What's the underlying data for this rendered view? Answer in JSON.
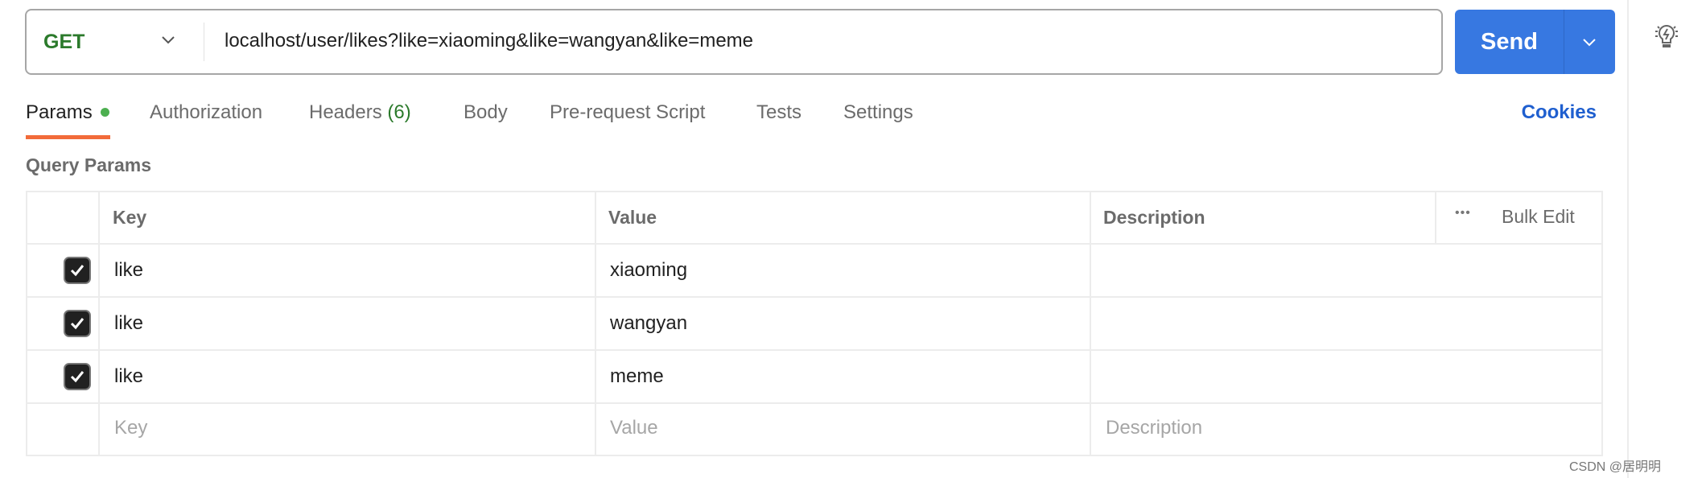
{
  "request": {
    "method": "GET",
    "url": "localhost/user/likes?like=xiaoming&like=wangyan&like=meme",
    "send_label": "Send"
  },
  "tabs": [
    {
      "label": "Params",
      "active": true,
      "has_dot": true
    },
    {
      "label": "Authorization"
    },
    {
      "label": "Headers",
      "count": "(6)"
    },
    {
      "label": "Body"
    },
    {
      "label": "Pre-request Script"
    },
    {
      "label": "Tests"
    },
    {
      "label": "Settings"
    }
  ],
  "cookies_label": "Cookies",
  "section_title": "Query Params",
  "table": {
    "headers": {
      "key": "Key",
      "value": "Value",
      "description": "Description",
      "bulk_edit": "Bulk Edit",
      "more": "•••"
    },
    "rows": [
      {
        "checked": true,
        "key": "like",
        "value": "xiaoming",
        "description": ""
      },
      {
        "checked": true,
        "key": "like",
        "value": "wangyan",
        "description": ""
      },
      {
        "checked": true,
        "key": "like",
        "value": "meme",
        "description": ""
      }
    ],
    "placeholders": {
      "key": "Key",
      "value": "Value",
      "description": "Description"
    }
  },
  "colors": {
    "accent": "#3778e1",
    "tab_underline": "#f26b3a",
    "method": "#2b7a2b",
    "cookies": "#1f5fcf"
  },
  "watermark": "CSDN @居明明"
}
